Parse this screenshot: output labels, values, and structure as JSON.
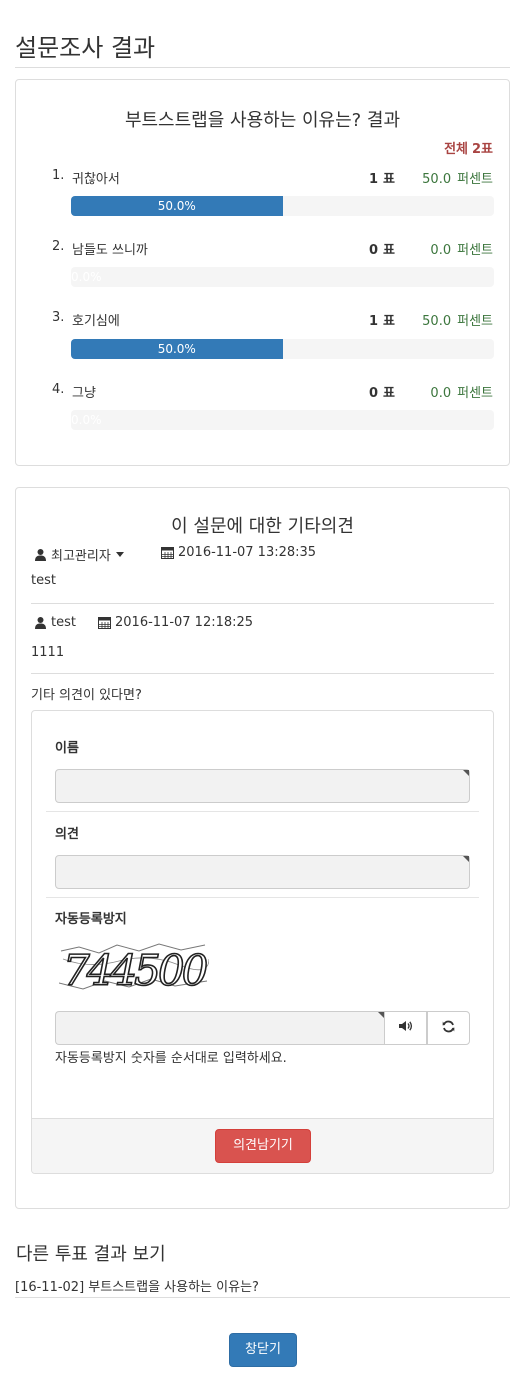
{
  "page": {
    "title": "설문조사 결과"
  },
  "poll": {
    "title": "부트스트랩을 사용하는 이유는? 결과",
    "total_label": "전체",
    "total_value": "2표",
    "vote_unit": "표",
    "percent_unit": "퍼센트",
    "items": [
      {
        "index": "1.",
        "label": "귀찮아서",
        "votes": "1",
        "percent": "50.0",
        "bar_label": "50.0%",
        "fill": 0.5
      },
      {
        "index": "2.",
        "label": "남들도 쓰니까",
        "votes": "0",
        "percent": "0.0",
        "bar_label": "0.0%",
        "fill": 0.0
      },
      {
        "index": "3.",
        "label": "호기심에",
        "votes": "1",
        "percent": "50.0",
        "bar_label": "50.0%",
        "fill": 0.5
      },
      {
        "index": "4.",
        "label": "그냥",
        "votes": "0",
        "percent": "0.0",
        "bar_label": "0.0%",
        "fill": 0.0
      }
    ]
  },
  "comments": {
    "title": "이 설문에 대한 기타의견",
    "entries": [
      {
        "author": "최고관리자",
        "datetime": "2016-11-07 13:28:35",
        "body": "test",
        "has_menu": true
      },
      {
        "author": "test",
        "datetime": "2016-11-07 12:18:25",
        "body": "1111",
        "has_menu": false
      }
    ],
    "form": {
      "prompt": "기타 의견이 있다면?",
      "name_label": "이름",
      "opinion_label": "의견",
      "captcha_label": "자동등록방지",
      "captcha_text": "744500",
      "captcha_help": "자동등록방지 숫자를 순서대로 입력하세요.",
      "submit_label": "의견남기기"
    }
  },
  "other": {
    "title": "다른 투표 결과 보기",
    "link": "[16-11-02] 부트스트랩을 사용하는 이유는?"
  },
  "close_label": "창닫기",
  "icons": {
    "user": "user-icon",
    "calendar": "calendar-icon",
    "audio": "volume-icon",
    "refresh": "refresh-icon",
    "caret": "caret-down-icon"
  },
  "colors": {
    "primary": "#337ab7",
    "danger": "#d9534f",
    "success_text": "#3c763d",
    "total_text": "#a94442"
  }
}
